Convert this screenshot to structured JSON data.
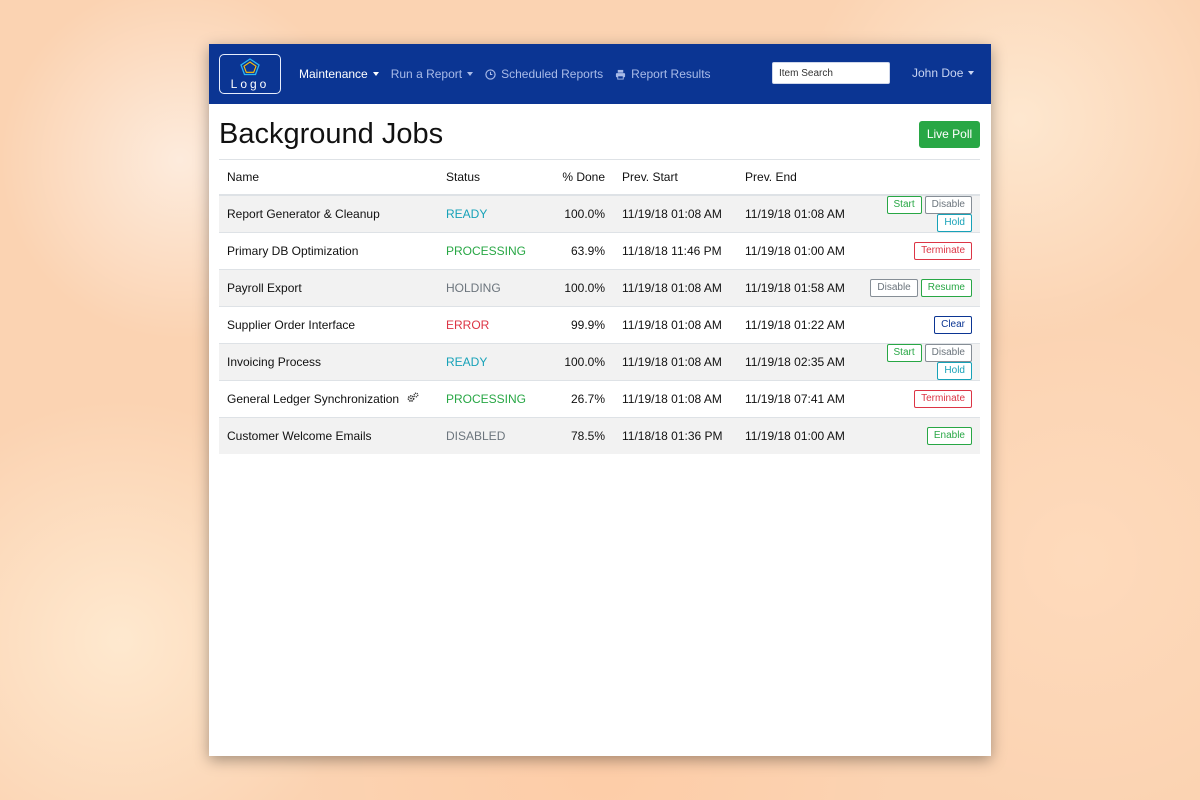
{
  "nav": {
    "logo_text": "Logo",
    "items": [
      {
        "label": "Maintenance",
        "icon": "",
        "dropdown": true,
        "active": true
      },
      {
        "label": "Run a Report",
        "icon": "",
        "dropdown": true,
        "active": false
      },
      {
        "label": "Scheduled Reports",
        "icon": "clock-icon",
        "dropdown": false,
        "active": false
      },
      {
        "label": "Report Results",
        "icon": "printer-icon",
        "dropdown": false,
        "active": false
      }
    ],
    "search_placeholder": "Item Search",
    "user_name": "John Doe"
  },
  "page": {
    "title": "Background Jobs",
    "live_poll_label": "Live Poll"
  },
  "table": {
    "headers": {
      "name": "Name",
      "status": "Status",
      "done": "% Done",
      "prev_start": "Prev. Start",
      "prev_end": "Prev. End"
    },
    "rows": [
      {
        "name": "Report Generator & Cleanup",
        "status": "READY",
        "status_type": "ready",
        "done": "100.0%",
        "prev_start": "11/19/18 01:08 AM",
        "prev_end": "11/19/18 01:08 AM",
        "gear": false,
        "actions": [
          {
            "label": "Start",
            "style": "green"
          },
          {
            "label": "Disable",
            "style": "gray"
          },
          {
            "label": "Hold",
            "style": "info"
          }
        ]
      },
      {
        "name": "Primary DB Optimization",
        "status": "PROCESSING",
        "status_type": "processing",
        "done": "63.9%",
        "prev_start": "11/18/18 11:46 PM",
        "prev_end": "11/19/18 01:00 AM",
        "gear": false,
        "actions": [
          {
            "label": "Terminate",
            "style": "red"
          }
        ]
      },
      {
        "name": "Payroll Export",
        "status": "HOLDING",
        "status_type": "holding",
        "done": "100.0%",
        "prev_start": "11/19/18 01:08 AM",
        "prev_end": "11/19/18 01:58 AM",
        "gear": false,
        "actions": [
          {
            "label": "Disable",
            "style": "gray"
          },
          {
            "label": "Resume",
            "style": "green"
          }
        ]
      },
      {
        "name": "Supplier Order Interface",
        "status": "ERROR",
        "status_type": "error",
        "done": "99.9%",
        "prev_start": "11/19/18 01:08 AM",
        "prev_end": "11/19/18 01:22 AM",
        "gear": false,
        "actions": [
          {
            "label": "Clear",
            "style": "blue"
          }
        ]
      },
      {
        "name": "Invoicing Process",
        "status": "READY",
        "status_type": "ready",
        "done": "100.0%",
        "prev_start": "11/19/18 01:08 AM",
        "prev_end": "11/19/18 02:35 AM",
        "gear": false,
        "actions": [
          {
            "label": "Start",
            "style": "green"
          },
          {
            "label": "Disable",
            "style": "gray"
          },
          {
            "label": "Hold",
            "style": "info"
          }
        ]
      },
      {
        "name": "General Ledger Synchronization",
        "status": "PROCESSING",
        "status_type": "processing",
        "done": "26.7%",
        "prev_start": "11/19/18 01:08 AM",
        "prev_end": "11/19/18 07:41 AM",
        "gear": true,
        "actions": [
          {
            "label": "Terminate",
            "style": "red"
          }
        ]
      },
      {
        "name": "Customer Welcome Emails",
        "status": "DISABLED",
        "status_type": "disabled",
        "done": "78.5%",
        "prev_start": "11/18/18 01:36 PM",
        "prev_end": "11/19/18 01:00 AM",
        "gear": false,
        "actions": [
          {
            "label": "Enable",
            "style": "green"
          }
        ]
      }
    ]
  },
  "colors": {
    "navbar": "#0b3593",
    "ready": "#17a2b8",
    "processing": "#28a745",
    "error": "#dc3545",
    "muted": "#6c757d",
    "primary_button": "#28a745"
  }
}
